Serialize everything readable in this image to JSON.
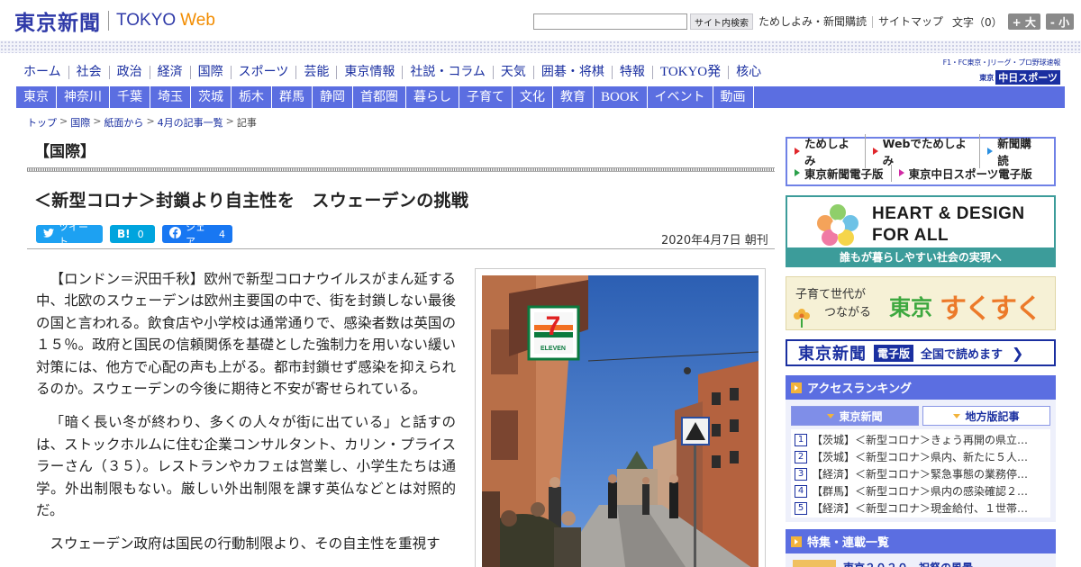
{
  "header": {
    "logo_jp": "東京新聞",
    "logo_en_1": "TOKYO",
    "logo_en_2": "Web",
    "search_placeholder": "",
    "search_button": "サイト内検索",
    "links": [
      "ためしよみ・新聞購読",
      "サイトマップ"
    ],
    "text_size_label": "文字（0）",
    "increase_label": "+ 大",
    "decrease_label": "- 小"
  },
  "nav_main": [
    "ホーム",
    "社会",
    "政治",
    "経済",
    "国際",
    "スポーツ",
    "芸能",
    "東京情報",
    "社説・コラム",
    "天気",
    "囲碁・将棋",
    "特報",
    "TOKYO発",
    "核心"
  ],
  "sports_logo": {
    "line1": "F1・FC東京・Jリーグ・プロ野球速報",
    "line2_small": "東京",
    "line2_main": "中日スポーツ"
  },
  "nav_sub": [
    "東京",
    "神奈川",
    "千葉",
    "埼玉",
    "茨城",
    "栃木",
    "群馬",
    "静岡",
    "首都圏",
    "暮らし",
    "子育て",
    "文化",
    "教育",
    "BOOK",
    "イベント",
    "動画"
  ],
  "breadcrumb": {
    "items": [
      "トップ",
      "国際",
      "紙面から",
      "4月の記事一覧"
    ],
    "current": "記事",
    "separator": ">"
  },
  "article": {
    "section": "【国際】",
    "headline": "＜新型コロナ＞封鎖より自主性を　スウェーデンの挑戦",
    "date": "2020年4月7日 朝刊",
    "social": {
      "tweet_label": "ツイート",
      "hatena_icon": "B!",
      "hatena_count": "0",
      "share_label": "シェア",
      "share_count": "4"
    },
    "paragraphs": [
      "【ロンドン＝沢田千秋】欧州で新型コロナウイルスがまん延する中、北欧のスウェーデンは欧州主要国の中で、街を封鎖しない最後の国と言われる。飲食店や小学校は通常通りで、感染者数は英国の１５％。政府と国民の信頼関係を基礎とした強制力を用いない緩い対策には、他方で心配の声も上がる。都市封鎖せず感染を抑えられるのか。スウェーデンの今後に期待と不安が寄せられている。",
      "「暗く長い冬が終わり、多くの人々が街に出ている」と話すのは、ストックホルムに住む企業コンサルタント、カリン・プライスラーさん（３５）。レストランやカフェは営業し、小学生たちは通学。外出制限もない。厳しい外出制限を課す英仏などとは対照的だ。",
      "スウェーデン政府は国民の行動制限より、その自主性を重視す"
    ],
    "photo": {
      "store_sign_number": "7",
      "store_sign_text": "ELEVEN"
    }
  },
  "sidebar": {
    "links_row1": [
      "ためしよみ",
      "Webでためしよみ",
      "新聞購読"
    ],
    "links_row2": [
      "東京新聞電子版",
      "東京中日スポーツ電子版"
    ],
    "heart_banner": {
      "line1": "HEART & DESIGN",
      "line2": "FOR ALL",
      "footer": "誰もが暮らしやすい社会の実現へ"
    },
    "sukusuku": {
      "text1": "子育て世代が",
      "text2": "つながる",
      "text3": "東京",
      "text4": "すくすく"
    },
    "digital_banner": {
      "name": "東京新聞",
      "tag": "電子版",
      "cta": "全国で読めます",
      "arrow": "❯"
    },
    "ranking": {
      "title": "アクセスランキング",
      "tabs": [
        "東京新聞",
        "地方版記事"
      ],
      "items": [
        {
          "rank": "1",
          "text": "【茨城】＜新型コロナ＞きょう再開の県立…"
        },
        {
          "rank": "2",
          "text": "【茨城】＜新型コロナ＞県内、新たに５人…"
        },
        {
          "rank": "3",
          "text": "【経済】＜新型コロナ＞緊急事態の業務停…"
        },
        {
          "rank": "4",
          "text": "【群馬】＜新型コロナ＞県内の感染確認２…"
        },
        {
          "rank": "5",
          "text": "【経済】＜新型コロナ＞現金給付、１世帯…"
        }
      ]
    },
    "features": {
      "title": "特集・連載一覧",
      "peek": "東京２０２０　祝祭の風景"
    }
  },
  "colors": {
    "brand_blue": "#2f3aa8",
    "nav_blue": "#5b6ee1",
    "accent_orange": "#f28c00",
    "teal": "#3c9c9a"
  }
}
